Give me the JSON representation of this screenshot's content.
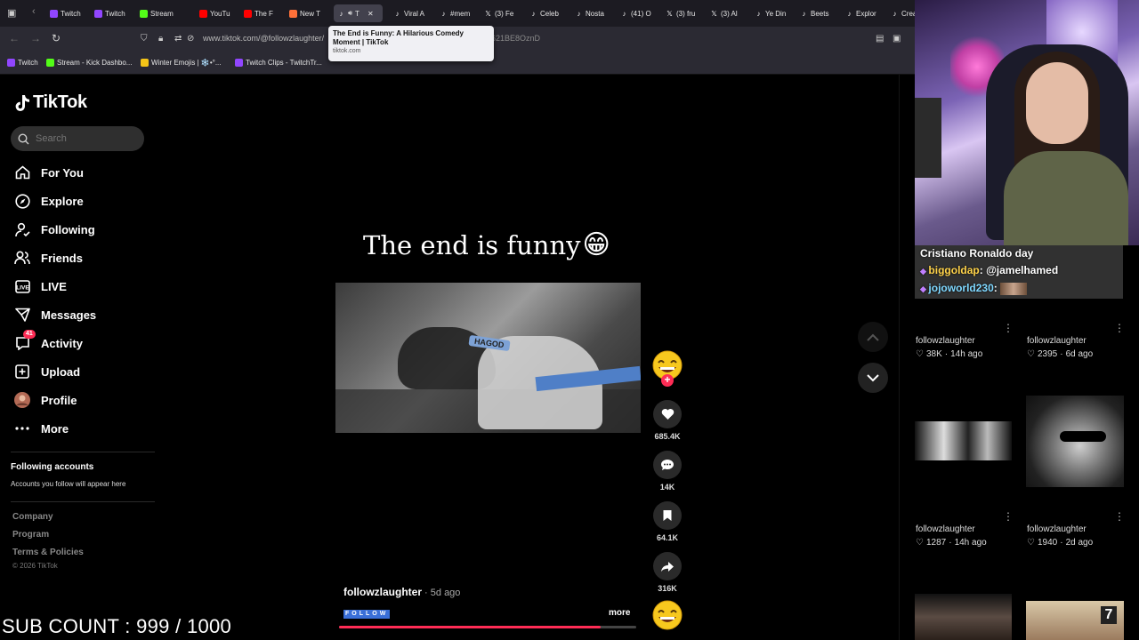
{
  "browser": {
    "tabs": [
      {
        "label": "Twitch",
        "icon": "twitch-icon",
        "color": "#9146ff"
      },
      {
        "label": "Twitch",
        "icon": "twitch-icon",
        "color": "#9146ff"
      },
      {
        "label": "Stream",
        "icon": "kick-icon",
        "color": "#53fc18"
      },
      {
        "label": "YouTu",
        "icon": "youtube-icon",
        "color": "#ff0000"
      },
      {
        "label": "The F",
        "icon": "youtube-icon",
        "color": "#ff0000"
      },
      {
        "label": "New T",
        "icon": "firefox-icon",
        "color": "#ff7139"
      },
      {
        "label": "T",
        "icon": "tiktok-icon",
        "color": "#ffffff",
        "active": true
      },
      {
        "label": "Viral A",
        "icon": "tiktok-icon",
        "color": "#ffffff"
      },
      {
        "label": "#mem",
        "icon": "tiktok-icon",
        "color": "#ffffff"
      },
      {
        "label": "(3) Fe",
        "icon": "x-icon",
        "color": "#ffffff"
      },
      {
        "label": "Celeb",
        "icon": "tiktok-icon",
        "color": "#ffffff"
      },
      {
        "label": "Nosta",
        "icon": "tiktok-icon",
        "color": "#ffffff"
      },
      {
        "label": "(41) O",
        "icon": "tiktok-icon",
        "color": "#ffffff"
      },
      {
        "label": "(3) fru",
        "icon": "x-icon",
        "color": "#ffffff"
      },
      {
        "label": "(3) Al",
        "icon": "x-icon",
        "color": "#ffffff"
      },
      {
        "label": "Ye Din",
        "icon": "tiktok-icon",
        "color": "#ffffff"
      },
      {
        "label": "Beets",
        "icon": "tiktok-icon",
        "color": "#ffffff"
      },
      {
        "label": "Explor",
        "icon": "tiktok-icon",
        "color": "#ffffff"
      },
      {
        "label": "Crea",
        "icon": "tiktok-icon",
        "color": "#ffffff"
      }
    ],
    "url": "www.tiktok.com/@followzlaughter/",
    "url_tail": "621BE8OznD",
    "tooltip": {
      "title": "The End is Funny: A Hilarious Comedy Moment | TikTok",
      "url": "tiktok.com"
    },
    "bookmarks": [
      {
        "label": "Twitch",
        "color": "#9146ff"
      },
      {
        "label": "Stream - Kick Dashbo...",
        "color": "#53fc18"
      },
      {
        "label": "Winter Emojis | ❄️•°...",
        "color": "#f5c518"
      },
      {
        "label": "Twitch Clips - TwitchTr...",
        "color": "#9146ff"
      }
    ]
  },
  "sidebar": {
    "logo_text": "TikTok",
    "search_placeholder": "Search",
    "nav": [
      {
        "label": "For You",
        "icon": "home-icon"
      },
      {
        "label": "Explore",
        "icon": "compass-icon"
      },
      {
        "label": "Following",
        "icon": "following-icon"
      },
      {
        "label": "Friends",
        "icon": "friends-icon"
      },
      {
        "label": "LIVE",
        "icon": "live-icon"
      },
      {
        "label": "Messages",
        "icon": "messages-icon"
      },
      {
        "label": "Activity",
        "icon": "activity-icon",
        "badge": "41"
      },
      {
        "label": "Upload",
        "icon": "upload-icon"
      },
      {
        "label": "Profile",
        "icon": "profile-avatar"
      },
      {
        "label": "More",
        "icon": "more-icon"
      }
    ],
    "following_heading": "Following accounts",
    "following_sub": "Accounts you follow will appear here",
    "footer_links": [
      "Company",
      "Program",
      "Terms & Policies"
    ],
    "copyright": "© 2026 TikTok"
  },
  "overlay": {
    "sub_count": "SUB COUNT : 999 / 1000"
  },
  "video": {
    "caption_text": "The end is funny",
    "caption_emoji": "😁",
    "sign_text": "HAGOD",
    "author": "followzlaughter",
    "posted": " · 5d ago",
    "follow_tag": "FOLLOW",
    "more_label": "more",
    "progress": 0.88,
    "actions": {
      "likes": "685.4K",
      "comments": "14K",
      "saves": "64.1K",
      "shares": "316K"
    }
  },
  "stream": {
    "chat": [
      {
        "nick": "",
        "text": "Cristiano Ronaldo day"
      },
      {
        "nick": "biggoldap",
        "text": ": @jamelhamed"
      },
      {
        "nick": "jojoworld230",
        "text": ":"
      }
    ]
  },
  "grid": [
    {
      "author": "followzlaughter",
      "likes": "38K",
      "ago": "14h ago"
    },
    {
      "author": "followzlaughter",
      "likes": "2395",
      "ago": "6d ago"
    },
    {
      "author": "followzlaughter",
      "likes": "1287",
      "ago": "14h ago"
    },
    {
      "author": "followzlaughter",
      "likes": "1940",
      "ago": "2d ago"
    }
  ],
  "grid_thumb_badge": "7"
}
